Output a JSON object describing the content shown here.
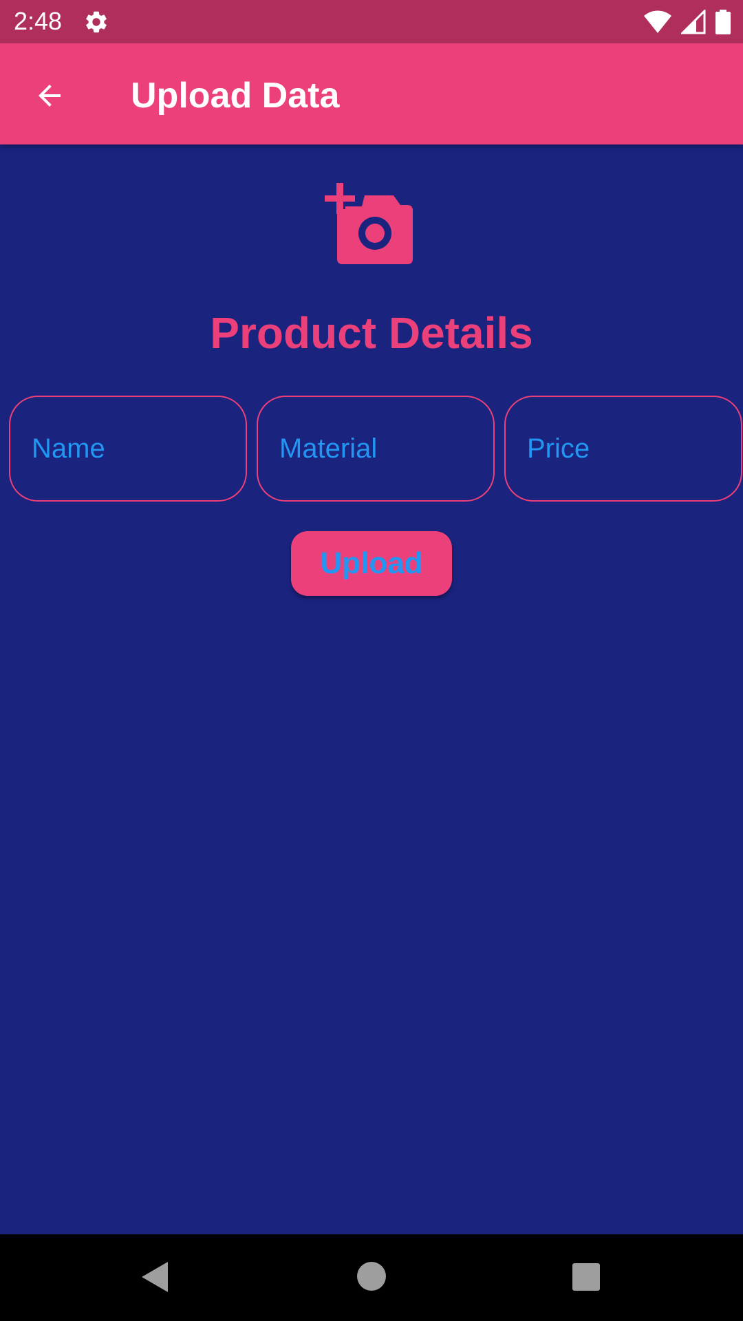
{
  "status_bar": {
    "time": "2:48",
    "icons": [
      "gear-icon",
      "wifi-icon",
      "signal-icon",
      "battery-icon"
    ]
  },
  "app_bar": {
    "title": "Upload Data",
    "back_icon": "arrow-left-icon"
  },
  "content": {
    "camera_icon": "add-a-photo-icon",
    "section_title": "Product Details",
    "fields": {
      "name": {
        "placeholder": "Name",
        "value": ""
      },
      "material": {
        "placeholder": "Material",
        "value": ""
      },
      "price": {
        "placeholder": "Price",
        "value": ""
      }
    },
    "upload_label": "Upload"
  },
  "nav_bar": {
    "icons": [
      "nav-back-icon",
      "nav-home-icon",
      "nav-recents-icon"
    ]
  },
  "colors": {
    "background": "#1a237e",
    "accent": "#ec407a",
    "status_bar": "#b02e5c",
    "hint_text": "#2196f3"
  }
}
